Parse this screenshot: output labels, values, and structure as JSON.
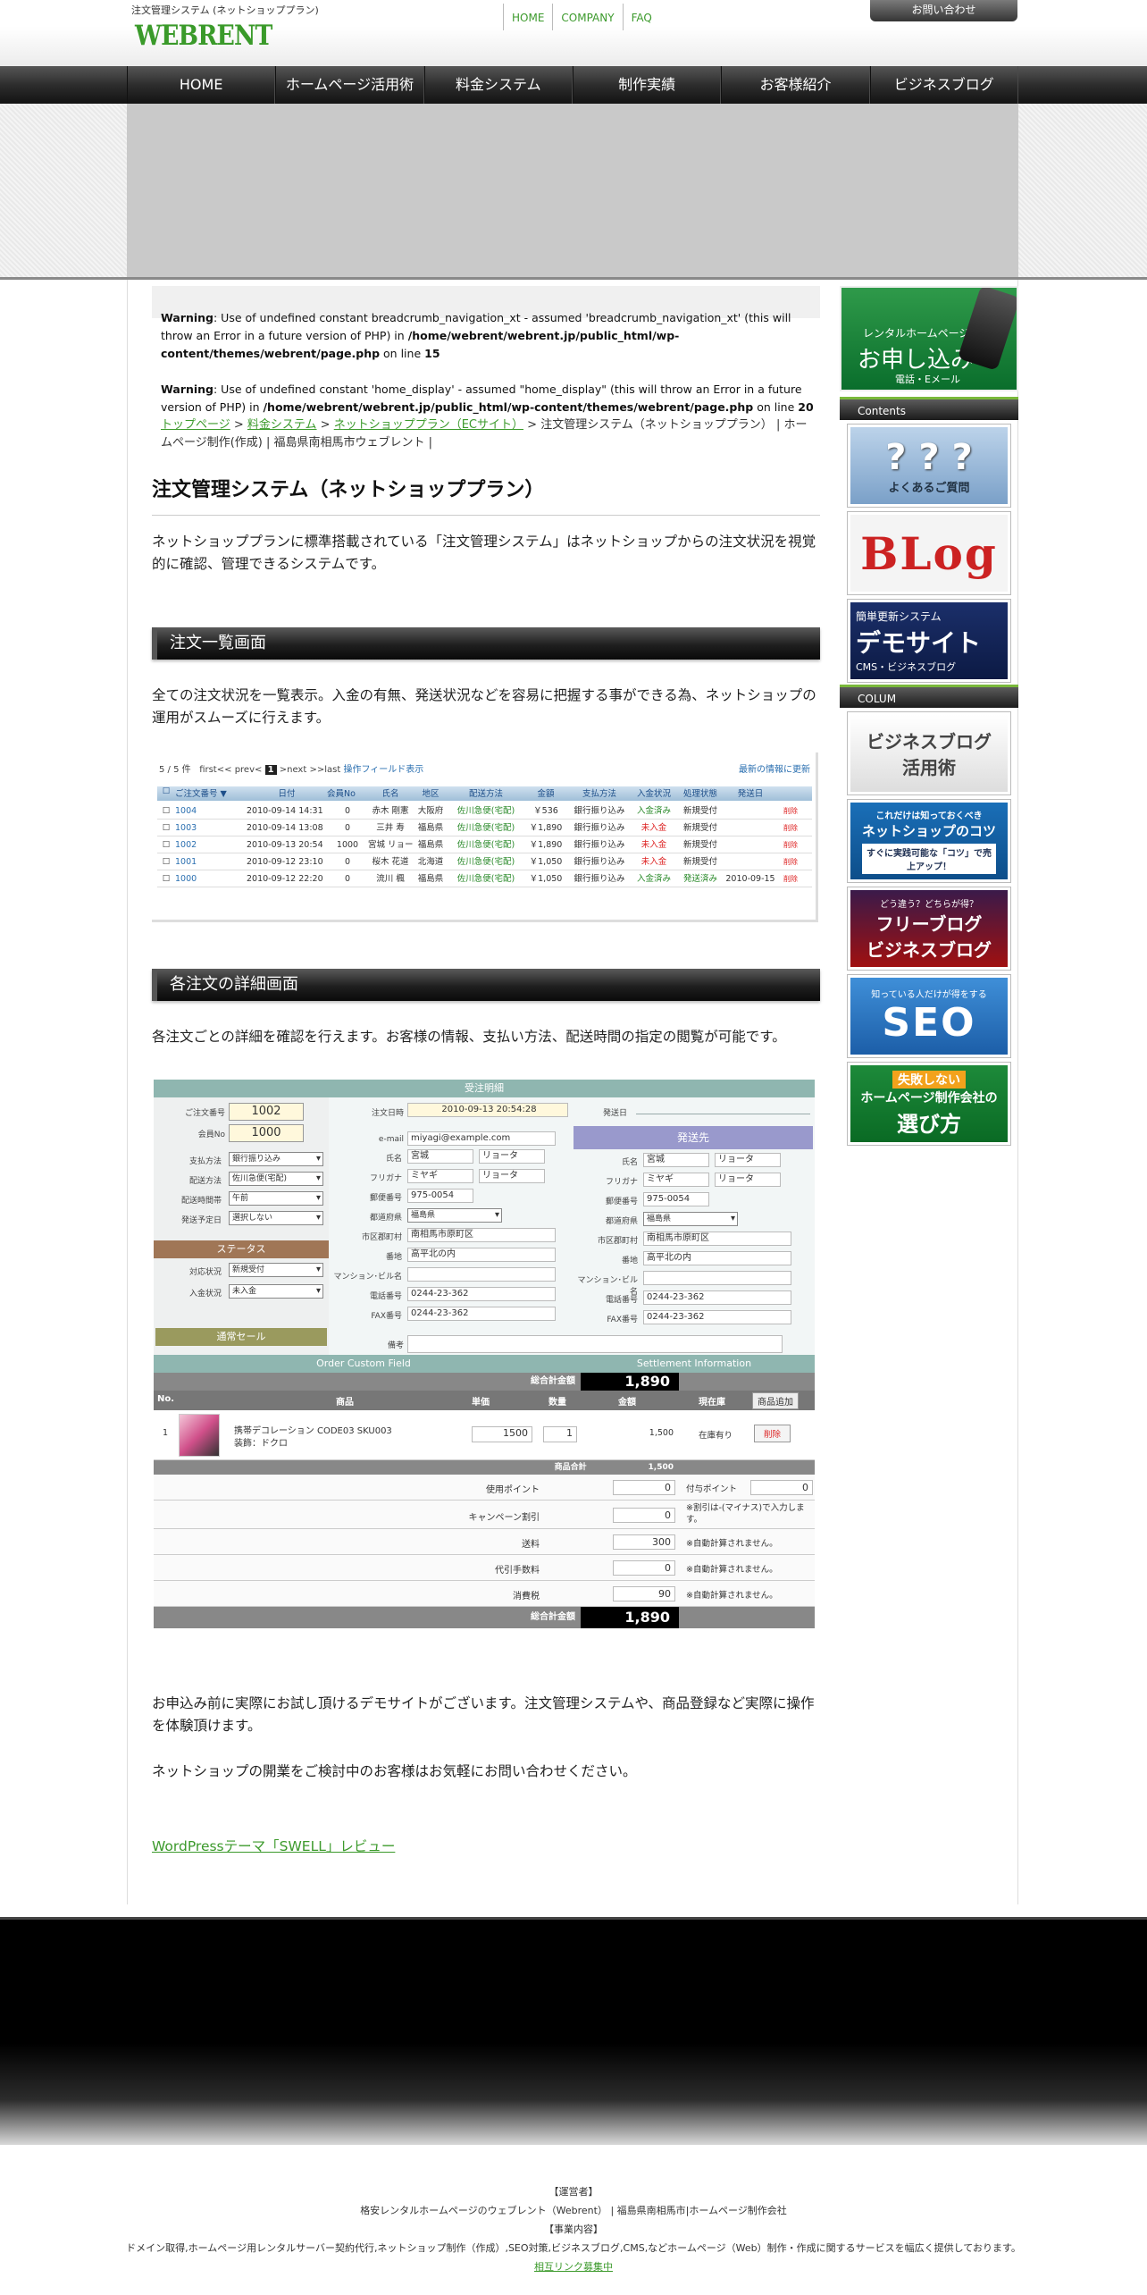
{
  "site": {
    "description": "注文管理システム (ネットショッププラン)",
    "logo": "WEBRENT",
    "top_links": [
      "HOME",
      "COMPANY",
      "FAQ"
    ],
    "inquiry": "お問い合わせ"
  },
  "nav": [
    "HOME",
    "ホームページ活用術",
    "料金システム",
    "制作実績",
    "お客様紹介",
    "ビジネスブログ"
  ],
  "warnings": [
    {
      "label": "Warning",
      "text1": ": Use of undefined constant breadcrumb_navigation_xt - assumed 'breadcrumb_navigation_xt' (this will throw an Error in a future version of PHP) in ",
      "path": "/home/webrent/webrent.jp/public_html/wp-content/themes/webrent/page.php",
      "text2": " on line ",
      "line": "15"
    },
    {
      "label": "Warning",
      "text1": ": Use of undefined constant 'home_display' - assumed \"home_display\" (this will throw an Error in a future version of PHP) in ",
      "path": "/home/webrent/webrent.jp/public_html/wp-content/themes/webrent/page.php",
      "text2": " on line ",
      "line": "20"
    }
  ],
  "breadcrumb": {
    "items": [
      "トップページ",
      "料金システム",
      "ネットショッププラン（ECサイト）"
    ],
    "current": "注文管理システム（ネットショッププラン）",
    "tail": "ホームページ制作(作成) | 福島県南相馬市ウェブレント |"
  },
  "page": {
    "title": "注文管理システム（ネットショッププラン）",
    "intro": "ネットショッププランに標準搭載されている「注文管理システム」はネットショップからの注文状況を視覚的に確認、管理できるシステムです。",
    "section1_title": "注文一覧画面",
    "section1_text": "全ての注文状況を一覧表示。入金の有無、発送状況などを容易に把握する事ができる為、ネットショップの運用がスムーズに行えます。",
    "section2_title": "各注文の詳細画面",
    "section2_text": "各注文ごとの詳細を確認を行えます。お客様の情報、支払い方法、配送時間の指定の閲覧が可能です。",
    "outro1": "お申込み前に実際にお試し頂けるデモサイトがございます。注文管理システムや、商品登録など実際に操作を体験頂けます。",
    "outro2": "ネットショップの開業をご検討中のお客様はお気軽にお問い合わせください。",
    "link": "WordPressテーマ「SWELL」レビュー"
  },
  "order_list": {
    "pager": [
      "5 / 5 件",
      "first<<",
      "prev<",
      "1",
      ">next",
      ">>last",
      "操作フィールド表示"
    ],
    "update": "最新の情報に更新",
    "headers": [
      "",
      "ご注文番号 ▼",
      "日付",
      "会員No",
      "氏名",
      "地区",
      "配送方法",
      "金額",
      "支払方法",
      "入金状況",
      "処理状態",
      "発送日",
      ""
    ],
    "rows": [
      [
        "1004",
        "2010-09-14 14:31",
        "0",
        "赤木 剛憲",
        "大阪府",
        "佐川急便(宅配)",
        "￥536",
        "銀行振り込み",
        "入金済み",
        "新規受付",
        "",
        "削除"
      ],
      [
        "1003",
        "2010-09-14 13:08",
        "0",
        "三井 寿",
        "福島県",
        "佐川急便(宅配)",
        "￥1,890",
        "銀行振り込み",
        "未入金",
        "新規受付",
        "",
        "削除"
      ],
      [
        "1002",
        "2010-09-13 20:54",
        "1000",
        "宮城 リョータ",
        "福島県",
        "佐川急便(宅配)",
        "￥1,890",
        "銀行振り込み",
        "未入金",
        "新規受付",
        "",
        "削除"
      ],
      [
        "1001",
        "2010-09-12 23:10",
        "0",
        "桜木 花道",
        "北海道",
        "佐川急便(宅配)",
        "￥1,050",
        "銀行振り込み",
        "未入金",
        "新規受付",
        "",
        "削除"
      ],
      [
        "1000",
        "2010-09-12 22:20",
        "0",
        "流川 楓",
        "福島県",
        "佐川急便(宅配)",
        "￥1,050",
        "銀行振り込み",
        "入金済み",
        "発送済み",
        "2010-09-15",
        "削除"
      ]
    ]
  },
  "order_detail": {
    "title": "受注明細",
    "order_no_label": "ご注文番号",
    "order_no": "1002",
    "member_label": "会員No",
    "member": "1000",
    "date_label": "注文日時",
    "date": "2010-09-13 20:54:28",
    "ship_date_label": "発送日",
    "pay_label": "支払方法",
    "pay": "銀行振り込み",
    "delivery_label": "配送方法",
    "delivery": "佐川急便(宅配)",
    "time_label": "配送時間帯",
    "time": "午前",
    "plan_label": "発送予定日",
    "plan": "選択しない",
    "status_title": "ステータス",
    "handle_label": "対応状況",
    "handle": "新規受付",
    "paid_label": "入金状況",
    "paid": "未入金",
    "sale": "通常セール",
    "email_label": "e-mail",
    "email": "miyagi@example.com",
    "ship_title": "発送先",
    "buyer": {
      "name_label": "氏名",
      "sei": "宮城",
      "mei": "リョータ",
      "kana_label": "フリガナ",
      "kana_sei": "ミヤギ",
      "kana_mei": "リョータ",
      "zip_label": "郵便番号",
      "zip": "975-0054",
      "pref_label": "都道府県",
      "pref": "福島県",
      "city_label": "市区郡町村",
      "city": "南相馬市原町区",
      "addr_label": "番地",
      "addr": "高平北の内",
      "bldg_label": "マンション･ビル名",
      "tel_label": "電話番号",
      "tel": "0244-23-362",
      "fax_label": "FAX番号",
      "fax": "0244-23-362"
    },
    "note_label": "備考",
    "custom_field": "Order Custom Field",
    "settlement": "Settlement Information",
    "total_label": "総合計金額",
    "total": "1,890",
    "item_headers": [
      "No.",
      "",
      "商品",
      "単価",
      "数量",
      "金額",
      "現在庫"
    ],
    "add_item": "商品追加",
    "item": {
      "no": "1",
      "name": "携帯デコレーション CODE03 SKU003",
      "option": "装飾：ドクロ",
      "price": "1500",
      "qty": "1",
      "amount": "1,500",
      "stock": "在庫有り",
      "delete": "削除"
    },
    "subtotal_label": "商品合計",
    "subtotal": "1,500",
    "use_point_label": "使用ポイント",
    "use_point": "0",
    "give_point_label": "付与ポイント",
    "give_point": "0",
    "campaign_label": "キャンペーン割引",
    "campaign": "0",
    "campaign_note": "※割引は-(マイナス)で入力します。",
    "shipping_label": "送料",
    "shipping": "300",
    "cod_label": "代引手数料",
    "cod": "0",
    "tax_label": "消費税",
    "tax": "90",
    "auto_note": "※自動計算されません。"
  },
  "sidebar": {
    "apply": {
      "line1": "レンタルホームページ",
      "line2": "お申し込み",
      "line3": "電話・Eメール"
    },
    "contents_title": "Contents",
    "faq": "よくあるご質問",
    "blog": "BLog",
    "demo": {
      "line1": "簡単更新システム",
      "line2": "デモサイト",
      "line3": "CMS・ビジネスブログ"
    },
    "column_title": "COLUM",
    "bizblog": {
      "line1": "ビジネスブログ",
      "line2": "活用術"
    },
    "tips": {
      "line1": "これだけは知っておくべき",
      "line2": "ネットショップのコツ",
      "line3": "すぐに実践可能な「コツ」で売上アップ！"
    },
    "free": {
      "line1": "どう違う？どちらが得？",
      "line2": "フリーブログ",
      "line3": "ビジネスブログ"
    },
    "seo": {
      "line1": "知っている人だけが得をする",
      "line2": "SEO"
    },
    "choose": {
      "line1": "失敗しない",
      "line2": "ホームページ制作会社の",
      "line3": "選び方"
    }
  },
  "footer": {
    "operator_title": "【運営者】",
    "operator": "格安レンタルホームページのウェブレント（Webrent） | 福島県南相馬市|ホームページ制作会社",
    "business_title": "【事業内容】",
    "business": "ドメイン取得,ホームページ用レンタルサーバー契約代行,ネットショップ制作（作成）,SEO対策,ビジネスブログ,CMS,などホームページ（Web）制作・作成に関するサービスを幅広く提供しております。",
    "link": "相互リンク募集中"
  }
}
